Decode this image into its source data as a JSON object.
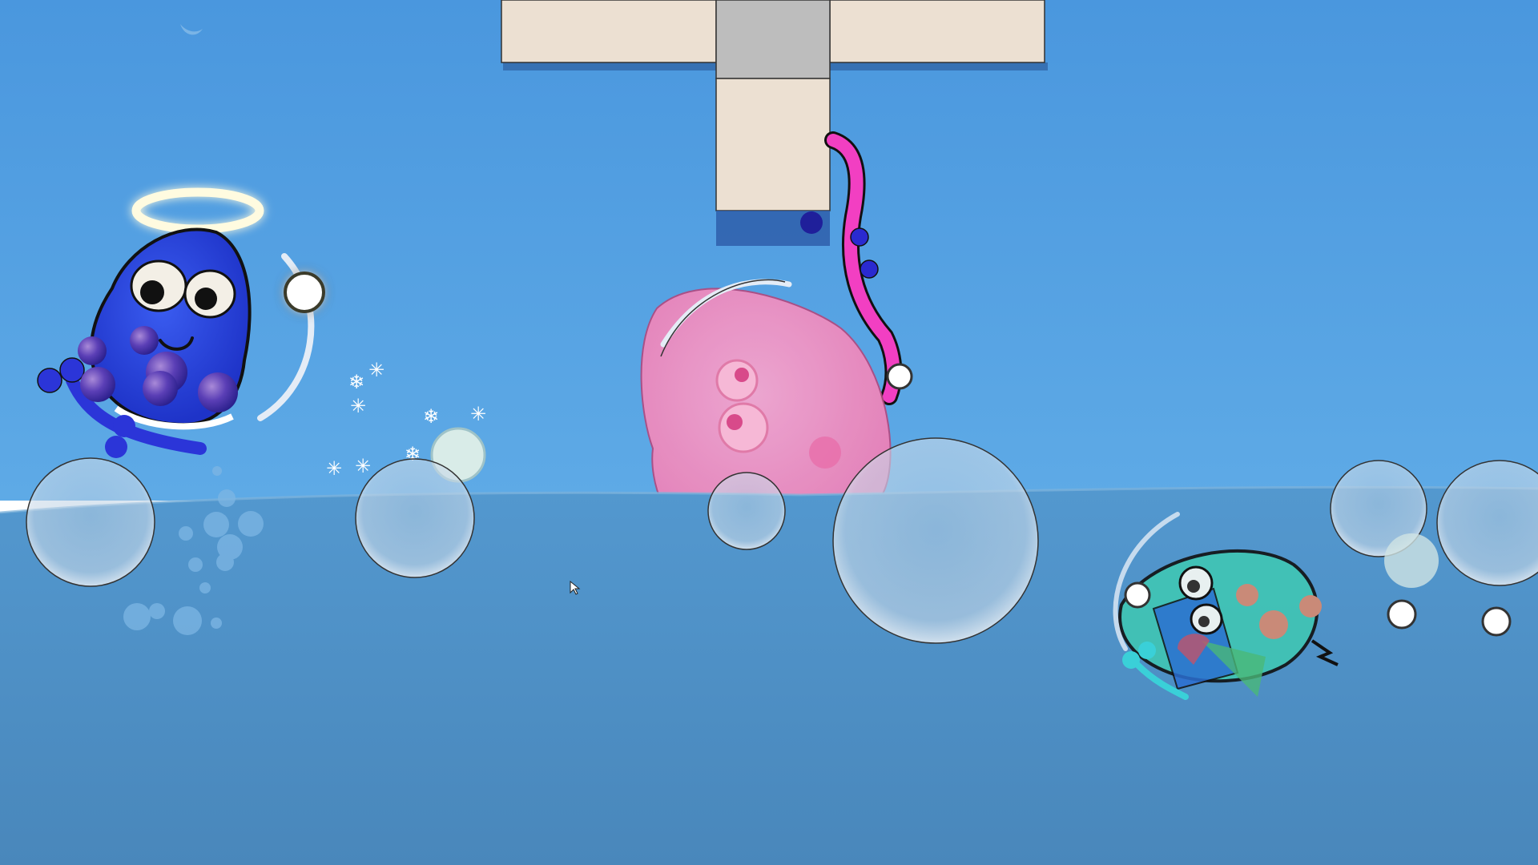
{
  "scene": {
    "type": "physics-party-game",
    "hud_text": "",
    "colors": {
      "sky_top": "#4a9ae0",
      "sky_bottom": "#5aa6e4",
      "water_top": "#4f97cf",
      "water_bottom": "#4a8cc0",
      "platform": "#ece0d2",
      "platform_shadow": "#2f5f9f",
      "player_blue": "#2a46d8",
      "player_pink": "#f084b8",
      "player_magenta": "#f040c0",
      "player_teal": "#3cc4b4"
    }
  },
  "players": [
    {
      "id": "blue-angel",
      "state": "eliminated",
      "has_halo": true
    },
    {
      "id": "pink-blob",
      "state": "alive"
    },
    {
      "id": "magenta-rope",
      "state": "alive"
    },
    {
      "id": "teal-blob",
      "state": "submerged"
    }
  ],
  "icons": {
    "halo": "halo-icon",
    "snowflake": "snowflake-icon",
    "cursor": "mouse-cursor-icon"
  }
}
